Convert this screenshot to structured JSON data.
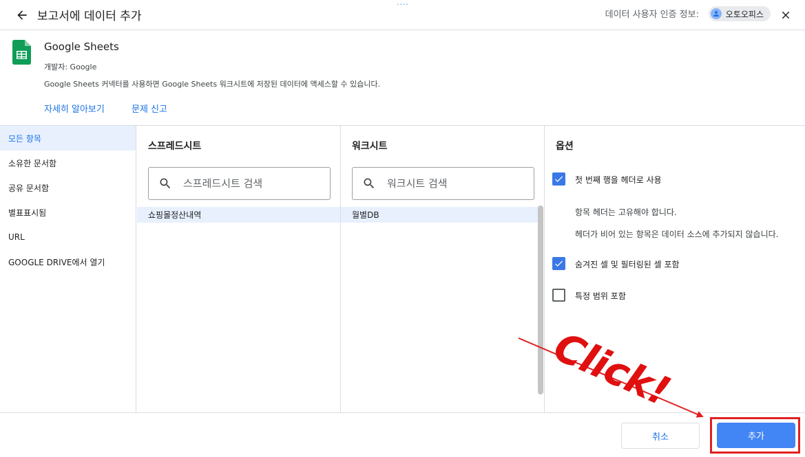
{
  "header": {
    "title": "보고서에 데이터 추가",
    "drag_handle": "....",
    "credentials_label": "데이터 사용자 인증 정보:",
    "credentials_user": "오토오피스"
  },
  "connector": {
    "name": "Google Sheets",
    "developer": "개발자: Google",
    "description": "Google Sheets 커넥터를 사용하면 Google Sheets 워크시트에 저장된 데이터에 액세스할 수 있습니다.",
    "learn_more": "자세히 알아보기",
    "report_issue": "문제 신고"
  },
  "sidebar": {
    "items": [
      {
        "label": "모든 항목",
        "active": true
      },
      {
        "label": "소유한 문서함"
      },
      {
        "label": "공유 문서함"
      },
      {
        "label": "별표표시됨"
      },
      {
        "label": "URL"
      },
      {
        "label": "GOOGLE DRIVE에서 열기"
      }
    ]
  },
  "spreadsheet_panel": {
    "title": "스프레드시트",
    "search_placeholder": "스프레드시트 검색",
    "items": [
      "쇼핑몰정산내역"
    ]
  },
  "worksheet_panel": {
    "title": "워크시트",
    "search_placeholder": "워크시트 검색",
    "items": [
      "월별DB"
    ]
  },
  "options": {
    "title": "옵션",
    "use_header": {
      "label": "첫 번째 행을 헤더로 사용",
      "checked": true
    },
    "header_note_1": "항목 헤더는 고유해야 합니다.",
    "header_note_2": "헤더가 비어 있는 항목은 데이터 소스에 추가되지 않습니다.",
    "include_hidden": {
      "label": "숨겨진 셀 및 필터링된 셀 포함",
      "checked": true
    },
    "specific_range": {
      "label": "특정 범위 포함",
      "checked": false
    }
  },
  "footer": {
    "cancel_label": "취소",
    "add_label": "추가"
  },
  "annotation": {
    "text": "Click!",
    "color": "#e01010"
  },
  "colors": {
    "accent": "#1a73e8",
    "primary_button": "#4285f4",
    "sheets_green": "#0f9d58",
    "annotation_red": "#e02020"
  }
}
